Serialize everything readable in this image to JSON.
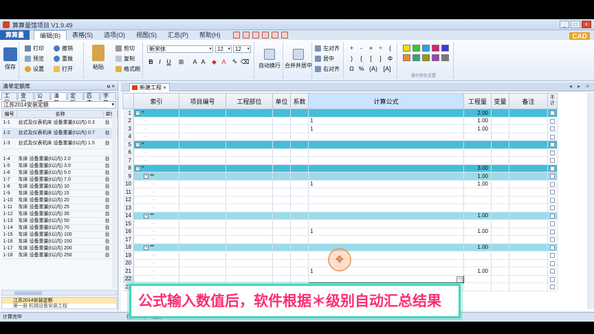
{
  "app": {
    "title": "算算量馆项目 V1.9.49",
    "cad_badge": "CAD"
  },
  "window_controls": [
    "_",
    "□",
    "×"
  ],
  "menu": {
    "app_button": "算算量",
    "items": [
      "编辑(B)",
      "表格(S)",
      "选项(O)",
      "视图(S)",
      "汇总(P)",
      "帮助(H)"
    ],
    "active_index": 0
  },
  "ribbon": {
    "save_label": "保存",
    "print": "打印",
    "undo": "撤销",
    "preview": "预览",
    "redo": "重做",
    "settings": "设置",
    "open": "打开",
    "paste": "粘贴",
    "cut": "剪切",
    "copy": "复制",
    "format_painter": "格式刷",
    "font": "新宋体",
    "font_size_a": "12",
    "font_size_b": "12",
    "auto_wrap": "自动换行",
    "merge_center": "合并并居中",
    "align_left": "左对齐",
    "align_center": "居中",
    "align_right": "右对齐",
    "symbols": [
      "+",
      "-",
      "×",
      "÷",
      "(",
      ")",
      "{",
      "[",
      "]",
      "Φ",
      "Ω",
      "%",
      "(A)",
      "[A]"
    ],
    "colors": [
      "#f6e000",
      "#37c837",
      "#1da8e6",
      "#e6187a",
      "#3a3ae0",
      "#f08c28",
      "#2aa88a",
      "#9b9b00",
      "#a03cc8",
      "#7a7a7a"
    ],
    "color_group_label": "操作颜色设置"
  },
  "left_panel": {
    "header": "清单定额库",
    "pin": "ᵾ ×",
    "tabs": [
      "工程",
      "变量",
      "公式",
      "清单",
      "定额",
      "匹查",
      "字符"
    ],
    "active_tab": 3,
    "library": "江苏2014安装定额",
    "columns": [
      "编号",
      "名称",
      "单位"
    ],
    "rows": [
      {
        "code": "1-1",
        "name": "台式及仪表机床  设备重量(t以内) 0.3",
        "unit": "台"
      },
      {
        "code": "1-2",
        "name": "台式及仪表机床  设备重量(t以内) 0.7",
        "unit": "台"
      },
      {
        "code": "1-3",
        "name": "台式及仪表机床  设备重量(t以内) 1.5",
        "unit": "台"
      },
      {
        "code": "",
        "name": "",
        "unit": ""
      },
      {
        "code": "1-4",
        "name": "车床  设备重量(t以内) 2.0",
        "unit": "台"
      },
      {
        "code": "1-5",
        "name": "车床  设备重量(t以内) 3.0",
        "unit": "台"
      },
      {
        "code": "1-6",
        "name": "车床  设备重量(t以内) 5.0",
        "unit": "台"
      },
      {
        "code": "1-7",
        "name": "车床  设备重量(t以内) 7.0",
        "unit": "台"
      },
      {
        "code": "1-8",
        "name": "车床  设备重量(t以内) 10",
        "unit": "台"
      },
      {
        "code": "1-9",
        "name": "车床  设备重量(t以内) 15",
        "unit": "台"
      },
      {
        "code": "1-10",
        "name": "车床  设备重量(t以内) 20",
        "unit": "台"
      },
      {
        "code": "1-11",
        "name": "车床  设备重量(t以内) 25",
        "unit": "台"
      },
      {
        "code": "1-12",
        "name": "车床  设备重量(t以内) 35",
        "unit": "台"
      },
      {
        "code": "1-13",
        "name": "车床  设备重量(t以内) 50",
        "unit": "台"
      },
      {
        "code": "1-14",
        "name": "车床  设备重量(t以内) 70",
        "unit": "台"
      },
      {
        "code": "1-15",
        "name": "车床  设备重量(t以内) 100",
        "unit": "台"
      },
      {
        "code": "1-16",
        "name": "车床  设备重量(t以内) 150",
        "unit": "台"
      },
      {
        "code": "1-17",
        "name": "车床  设备重量(t以内) 200",
        "unit": "台"
      },
      {
        "code": "1-18",
        "name": "车床  设备重量(t以内) 250",
        "unit": "台"
      }
    ],
    "bottom_item_1": "江苏2014安装定额",
    "bottom_item_2": "第一册  机械设备安装工程"
  },
  "document": {
    "tab": "新建工程",
    "tab_close": "×",
    "controls": "◂ ▸ ×"
  },
  "grid": {
    "columns": [
      "索引",
      "项目编号",
      "工程部位",
      "单位",
      "系数",
      "计算公式",
      "工程量",
      "变量",
      "备注",
      "不计"
    ],
    "rows": [
      {
        "n": "1",
        "idx": "*",
        "level": 1,
        "type": "star",
        "formula": "",
        "qty": "2.00"
      },
      {
        "n": "2",
        "idx": "",
        "level": 2,
        "type": "",
        "formula": "1",
        "qty": "1.00"
      },
      {
        "n": "3",
        "idx": "",
        "level": 2,
        "type": "",
        "formula": "1",
        "qty": "1.00"
      },
      {
        "n": "4",
        "idx": "",
        "level": 2,
        "type": "",
        "formula": "",
        "qty": ""
      },
      {
        "n": "5",
        "idx": "*",
        "level": 1,
        "type": "star",
        "formula": "",
        "qty": ""
      },
      {
        "n": "6",
        "idx": "",
        "level": 2,
        "type": "",
        "formula": "",
        "qty": ""
      },
      {
        "n": "7",
        "idx": "",
        "level": 2,
        "type": "",
        "formula": "",
        "qty": ""
      },
      {
        "n": "8",
        "idx": "*",
        "level": 1,
        "type": "star",
        "formula": "",
        "qty": "3.00"
      },
      {
        "n": "9",
        "idx": "**",
        "level": 2,
        "type": "dstar",
        "formula": "",
        "qty": "1.00"
      },
      {
        "n": "10",
        "idx": "",
        "level": 3,
        "type": "",
        "formula": "1",
        "qty": "1.00"
      },
      {
        "n": "11",
        "idx": "",
        "level": 3,
        "type": "",
        "formula": "",
        "qty": ""
      },
      {
        "n": "12",
        "idx": "",
        "level": 3,
        "type": "",
        "formula": "",
        "qty": ""
      },
      {
        "n": "13",
        "idx": "",
        "level": 3,
        "type": "",
        "formula": "",
        "qty": ""
      },
      {
        "n": "14",
        "idx": "**",
        "level": 2,
        "type": "dstar",
        "formula": "",
        "qty": "1.00"
      },
      {
        "n": "15",
        "idx": "",
        "level": 3,
        "type": "",
        "formula": "",
        "qty": ""
      },
      {
        "n": "16",
        "idx": "",
        "level": 3,
        "type": "",
        "formula": "1",
        "qty": "1.00"
      },
      {
        "n": "17",
        "idx": "",
        "level": 3,
        "type": "",
        "formula": "",
        "qty": ""
      },
      {
        "n": "18",
        "idx": "**",
        "level": 2,
        "type": "dstar",
        "formula": "",
        "qty": "1.00"
      },
      {
        "n": "19",
        "idx": "",
        "level": 3,
        "type": "",
        "formula": "",
        "qty": ""
      },
      {
        "n": "20",
        "idx": "",
        "level": 3,
        "type": "",
        "formula": "",
        "qty": ""
      },
      {
        "n": "21",
        "idx": "",
        "level": 3,
        "type": "",
        "formula": "1",
        "qty": "1.00"
      },
      {
        "n": "22",
        "idx": "",
        "level": 3,
        "type": "edit",
        "formula": "",
        "qty": ""
      },
      {
        "n": "23",
        "idx": "",
        "level": 3,
        "type": "",
        "formula": "",
        "qty": ""
      }
    ]
  },
  "subtitle": "公式输入数值后，软件根据＊级别自动汇总结果",
  "status": {
    "left": "计算完毕",
    "mid": "行: 22  列: 6  位置:"
  }
}
